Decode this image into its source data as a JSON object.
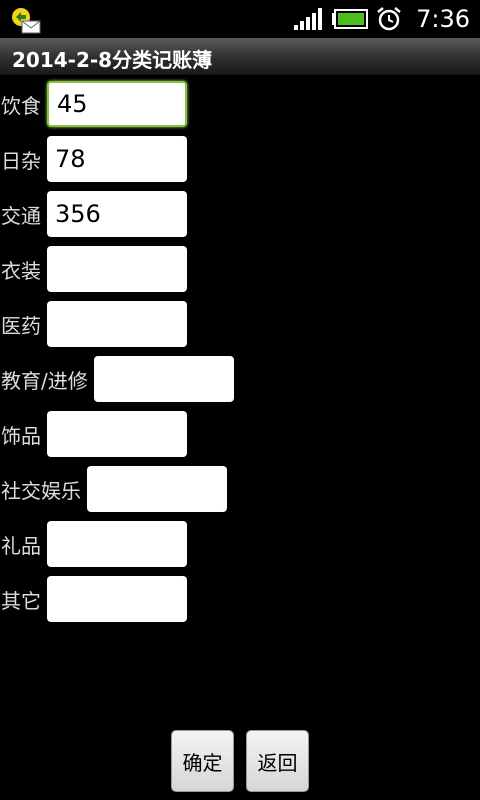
{
  "status_bar": {
    "time": "7:36",
    "icons": [
      "notification-mail-icon",
      "signal-icon",
      "battery-icon",
      "alarm-icon"
    ]
  },
  "title_bar": {
    "title": "2014-2-8分类记账薄"
  },
  "form": {
    "rows": [
      {
        "label": "饮食",
        "value": "45",
        "focused": true
      },
      {
        "label": "日杂",
        "value": "78"
      },
      {
        "label": "交通",
        "value": "356"
      },
      {
        "label": "衣装",
        "value": ""
      },
      {
        "label": "医药",
        "value": ""
      },
      {
        "label": "教育/进修",
        "value": ""
      },
      {
        "label": "饰品",
        "value": ""
      },
      {
        "label": "社交娱乐",
        "value": ""
      },
      {
        "label": "礼品",
        "value": ""
      },
      {
        "label": "其它",
        "value": ""
      }
    ]
  },
  "buttons": {
    "confirm_label": "确定",
    "back_label": "返回"
  },
  "colors": {
    "background": "#000000",
    "focus_border": "#86c33a",
    "battery_fill": "#4bbd1e"
  }
}
